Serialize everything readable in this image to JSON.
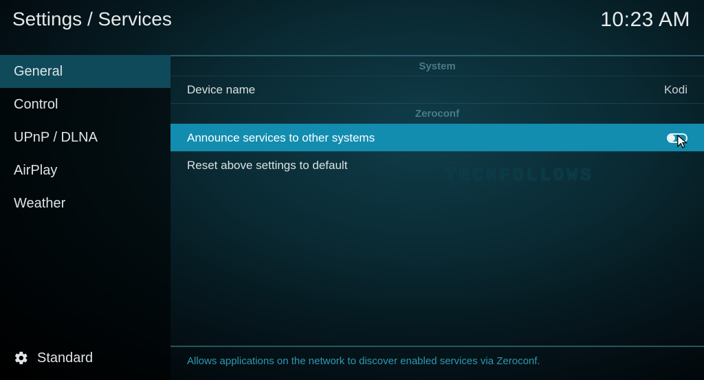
{
  "header": {
    "breadcrumb": "Settings / Services",
    "clock": "10:23 AM"
  },
  "sidebar": {
    "items": [
      {
        "label": "General",
        "selected": true
      },
      {
        "label": "Control",
        "selected": false
      },
      {
        "label": "UPnP / DLNA",
        "selected": false
      },
      {
        "label": "AirPlay",
        "selected": false
      },
      {
        "label": "Weather",
        "selected": false
      }
    ],
    "level_label": "Standard"
  },
  "main": {
    "groups": [
      {
        "header": "System",
        "rows": [
          {
            "label": "Device name",
            "value": "Kodi",
            "type": "text"
          }
        ]
      },
      {
        "header": "Zeroconf",
        "rows": [
          {
            "label": "Announce services to other systems",
            "type": "toggle",
            "toggle_on": false,
            "highlight": true
          },
          {
            "label": "Reset above settings to default",
            "type": "action"
          }
        ]
      }
    ]
  },
  "footer": {
    "help_text": "Allows applications on the network to discover enabled services via Zeroconf."
  },
  "watermark": "TECHFOLLOWS"
}
